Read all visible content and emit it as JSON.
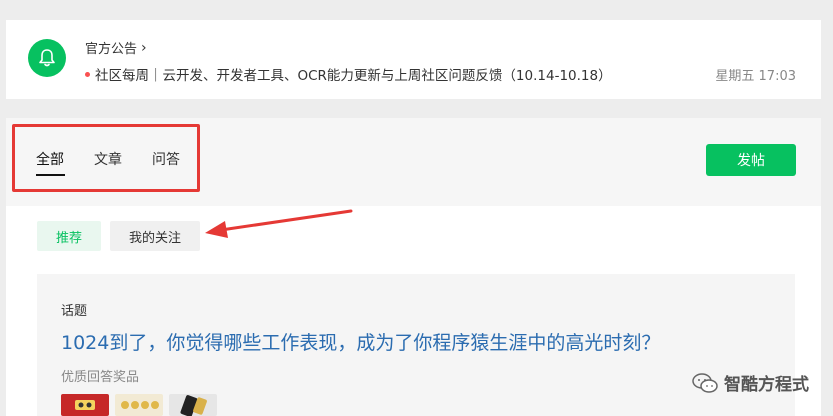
{
  "notice": {
    "title": "官方公告",
    "headline": "社区每周｜云开发、开发者工具、OCR能力更新与上周社区问题反馈（10.14-10.18）",
    "time": "星期五 17:03"
  },
  "tabs": [
    {
      "label": "全部",
      "active": true
    },
    {
      "label": "文章",
      "active": false
    },
    {
      "label": "问答",
      "active": false
    }
  ],
  "post_button": "发帖",
  "filters": {
    "recommend": "推荐",
    "following": "我的关注"
  },
  "topic": {
    "tag": "话题",
    "title": "1024到了，你觉得哪些工作表现，成为了你程序猿生涯中的高光时刻？",
    "subtitle": "优质回答奖品"
  },
  "watermark": "智酷方程式",
  "colors": {
    "brand_green": "#07c160",
    "highlight_red": "#e53935",
    "link_blue": "#2b6cb0"
  }
}
